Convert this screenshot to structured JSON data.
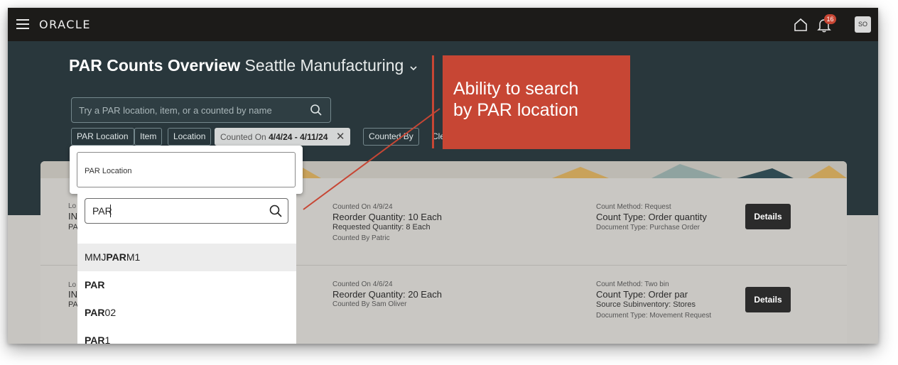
{
  "header": {
    "logo": "ORACLE",
    "notification_count": "16",
    "avatar_initials": "SO"
  },
  "page": {
    "title_main": "PAR Counts Overview",
    "title_sub": "Seattle Manufacturing"
  },
  "search": {
    "placeholder": "Try a PAR location, item, or a counted by name"
  },
  "filters": {
    "par_location": "PAR Location",
    "item": "Item",
    "location": "Location",
    "counted_on_label": "Counted On",
    "counted_on_value": "4/4/24 - 4/11/24",
    "counted_by": "Counted By",
    "clear": "Cle"
  },
  "dropdown": {
    "field_label": "PAR Location",
    "search_value": "PAR",
    "options": [
      {
        "prefix": "MMJ",
        "match": "PAR",
        "suffix": "M1"
      },
      {
        "prefix": "",
        "match": "PAR",
        "suffix": ""
      },
      {
        "prefix": "",
        "match": "PAR",
        "suffix": "02"
      },
      {
        "prefix": "",
        "match": "PAR",
        "suffix": "1"
      }
    ]
  },
  "rows": [
    {
      "left_small": "Lo",
      "left_big": "IN",
      "left_sub": "PA",
      "counted_on": "Counted On 4/9/24",
      "reorder": "Reorder Quantity: 10 Each",
      "requested": "Requested Quantity: 8 Each",
      "counted_by": "Counted By Patric",
      "count_method": "Count Method: Request",
      "count_type": "Count Type: Order quantity",
      "doc_type": "Document Type: Purchase Order",
      "button": "Details"
    },
    {
      "left_small": "Lo",
      "left_big": "IN",
      "left_sub": "PA",
      "counted_on": "Counted On 4/6/24",
      "reorder": "Reorder Quantity: 20 Each",
      "counted_by": "Counted By Sam Oliver",
      "count_method": "Count Method: Two bin",
      "count_type": "Count Type: Order par",
      "source_sub": "Source Subinventory: Stores",
      "doc_type": "Document Type: Movement Request",
      "button": "Details"
    }
  ],
  "callout": {
    "line1": "Ability to search",
    "line2": "by PAR location"
  },
  "colors": {
    "topbar": "#1c1b19",
    "hero": "#29373c",
    "accent": "#c74634",
    "button": "#2b2b2b"
  }
}
